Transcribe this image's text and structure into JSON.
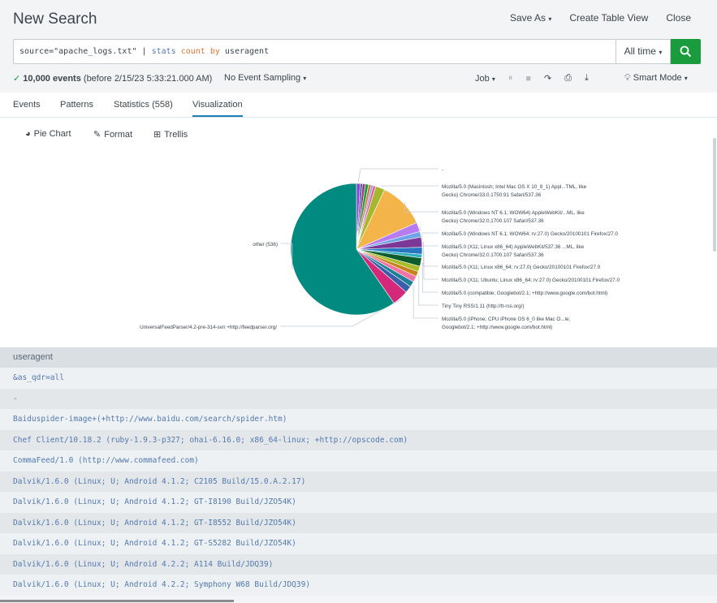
{
  "header": {
    "title": "New Search",
    "save_as": "Save As",
    "create_table_view": "Create Table View",
    "close": "Close"
  },
  "search": {
    "query_source": "source=\"apache_logs.txt\"",
    "query_pipe": " | ",
    "query_stats": "stats",
    "query_count": "count",
    "query_by": "by",
    "query_field": " useragent",
    "time_range": "All time"
  },
  "status": {
    "events_count": "10,000 events",
    "events_before": "(before 2/15/23 5:33:21.000 AM)",
    "sampling": "No Event Sampling",
    "job": "Job",
    "mode": "Smart Mode"
  },
  "tabs": [
    {
      "label": "Events"
    },
    {
      "label": "Patterns"
    },
    {
      "label": "Statistics (558)"
    },
    {
      "label": "Visualization"
    }
  ],
  "viz_toolbar": {
    "chart_type": "Pie Chart",
    "format": "Format",
    "trellis": "Trellis"
  },
  "chart_data": {
    "type": "pie",
    "total": 10000,
    "slices": [
      {
        "label": "-",
        "value": 80,
        "color": "#8b3fd9"
      },
      {
        "label": "",
        "value": 50,
        "color": "#3863a0"
      },
      {
        "label": "",
        "value": 60,
        "color": "#a02e80"
      },
      {
        "label": "",
        "value": 70,
        "color": "#1a9c3e"
      },
      {
        "label": "",
        "value": 60,
        "color": "#d7783b"
      },
      {
        "label": "",
        "value": 40,
        "color": "#5fa4e8"
      },
      {
        "label": "",
        "value": 60,
        "color": "#ec5a9a"
      },
      {
        "label": "Mozilla/5.0 (Macintosh; Intel Mac OS X 10_9_1) Appl...TML, like Gecko) Chrome/33.0.1750.91 Safari/537.36",
        "value": 200,
        "color": "#a5b82d"
      },
      {
        "label": "Mozilla/5.0 (Windows NT 6.1; WOW64) AppleWebKit/...ML, like Gecko) Chrome/32.0.1700.107 Safari/537.36",
        "value": 1000,
        "color": "#f3b54a"
      },
      {
        "label": "Mozilla/5.0 (Windows NT 6.1; WOW64; rv:27.0) Gecko/20100101 Firefox/27.0",
        "value": 200,
        "color": "#b77cf2"
      },
      {
        "label": "Mozilla/5.0 (X11; Linux x86_64) AppleWebKit/537.36 ...ML, like Gecko) Chrome/32.0.1700.107 Safari/537.36",
        "value": 120,
        "color": "#6da4e7"
      },
      {
        "label": "Mozilla/5.0 (X11; Linux x86_64; rv:27.0) Gecko/20100101 Firefox/27.0",
        "value": 220,
        "color": "#7c3896"
      },
      {
        "label": "Mozilla/5.0 (X11; Ubuntu; Linux x86_64; rv:27.0) Gecko/20100101 Firefox/27.0",
        "value": 150,
        "color": "#2875c2"
      },
      {
        "label": "",
        "value": 80,
        "color": "#2db0bf"
      },
      {
        "label": "Mozilla/5.0 (compatible; Googlebot/2.1; +http://www.google.com/bot.html)",
        "value": 180,
        "color": "#0d5c2e"
      },
      {
        "label": "",
        "value": 120,
        "color": "#a8bc28"
      },
      {
        "label": "Tiny Tiny RSS/1.11 (http://tt-rss.org/)",
        "value": 110,
        "color": "#c8821a"
      },
      {
        "label": "",
        "value": 130,
        "color": "#f273a3"
      },
      {
        "label": "Mozilla/5.0 (iPhone; CPU iPhone OS 6_0 like Mac O...le; Googlebot/2.1; +http://www.google.com/bot.html)",
        "value": 120,
        "color": "#1b8099"
      },
      {
        "label": "",
        "value": 150,
        "color": "#3b5ea9"
      },
      {
        "label": "UniversalFeedParser/4.2-pre-314-svn +http://feedparser.org/",
        "value": 350,
        "color": "#d4287a"
      },
      {
        "label": "other (536)",
        "value": 5250,
        "color": "#008a80"
      }
    ]
  },
  "table": {
    "header": "useragent",
    "rows": [
      "&as_qdr=all",
      "-",
      "Baiduspider-image+(+http://www.baidu.com/search/spider.htm)",
      "Chef Client/10.18.2 (ruby-1.9.3-p327; ohai-6.16.0; x86_64-linux; +http://opscode.com)",
      "CommaFeed/1.0 (http://www.commafeed.com)",
      "Dalvik/1.6.0 (Linux; U; Android 4.1.2; C2105 Build/15.0.A.2.17)",
      "Dalvik/1.6.0 (Linux; U; Android 4.1.2; GT-I8190 Build/JZO54K)",
      "Dalvik/1.6.0 (Linux; U; Android 4.1.2; GT-I8552 Build/JZO54K)",
      "Dalvik/1.6.0 (Linux; U; Android 4.1.2; GT-S5282 Build/JZO54K)",
      "Dalvik/1.6.0 (Linux; U; Android 4.2.2; A114 Build/JDQ39)",
      "Dalvik/1.6.0 (Linux; U; Android 4.2.2; Symphony W68 Build/JDQ39)"
    ]
  },
  "colors": {
    "accent": "#1a9c3e",
    "link": "#5379af",
    "tab_active": "#1a7fb5"
  }
}
